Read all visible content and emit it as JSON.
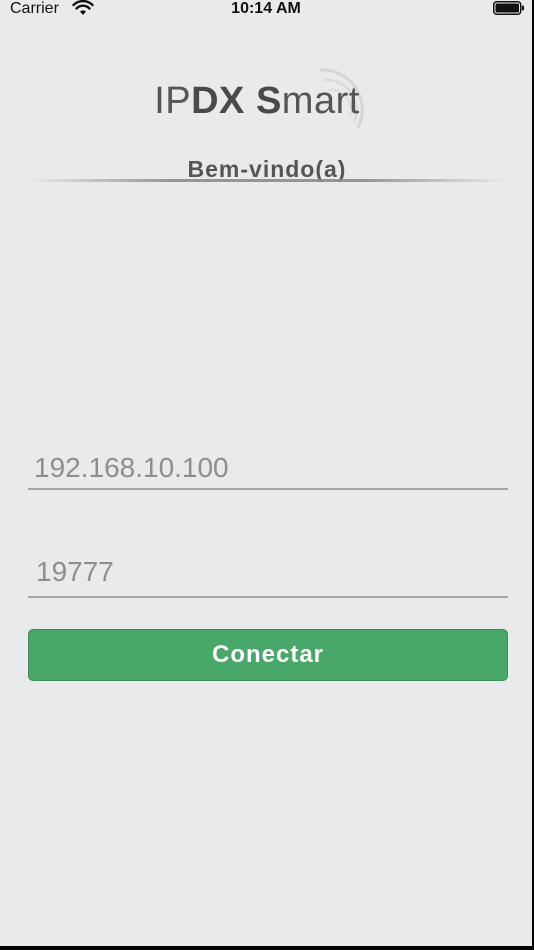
{
  "status_bar": {
    "carrier": "Carrier",
    "time": "10:14 AM"
  },
  "logo": {
    "prefix": "IP",
    "bold": "DX S",
    "suffix": "mart"
  },
  "welcome": "Bem-vindo(a)",
  "form": {
    "ip_placeholder": "192.168.10.100",
    "port_placeholder": "19777",
    "connect_label": "Conectar"
  },
  "colors": {
    "background": "#e9eaec",
    "button": "#4aa76a",
    "text_muted": "#8e8e8e"
  },
  "icons": [
    "wifi-icon",
    "battery-icon"
  ]
}
